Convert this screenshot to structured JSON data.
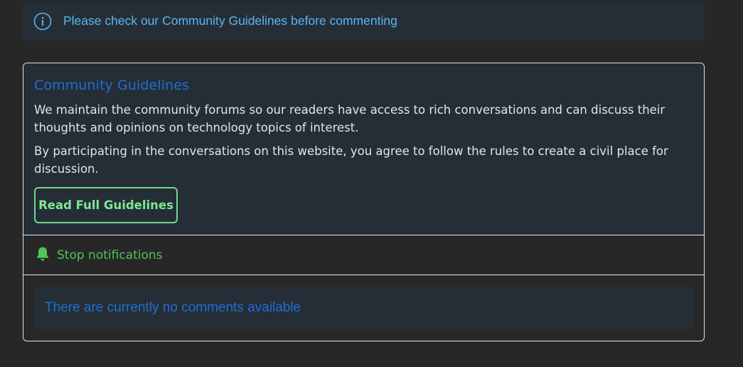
{
  "notice": {
    "icon": "info-circle-icon",
    "text": "Please check our Community Guidelines before commenting"
  },
  "guidelines": {
    "title": "Community Guidelines",
    "paragraphs": [
      "We maintain the community forums so our readers have access to rich conversations and can discuss their thoughts and opinions on technology topics of interest.",
      "By participating in the conversations on this website, you agree to follow the rules to create a civil place for discussion."
    ],
    "button_label": "Read Full Guidelines"
  },
  "notifications": {
    "icon": "bell-icon",
    "label": "Stop notifications"
  },
  "comments": {
    "empty_text": "There are currently no comments available"
  },
  "colors": {
    "background": "#272727",
    "panel": "#252e37",
    "notice_text": "#5ab6f0",
    "title_blue": "#1f6fd0",
    "button_green": "#6fd88a",
    "notification_green": "#4fc45a"
  }
}
